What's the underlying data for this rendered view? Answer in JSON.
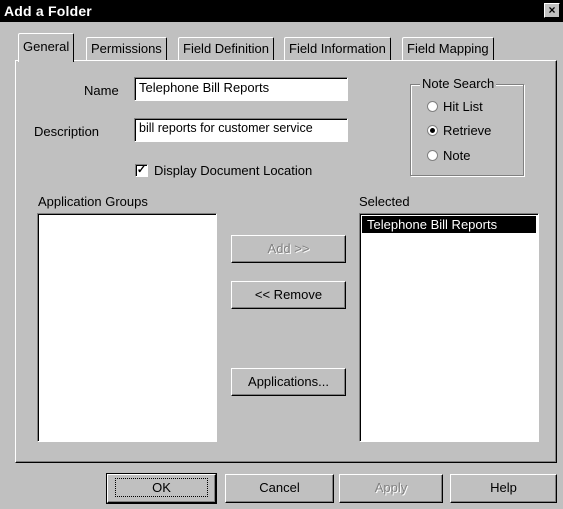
{
  "window": {
    "title": "Add a Folder",
    "close_glyph": "×"
  },
  "tabs": [
    {
      "label": "General",
      "active": true
    },
    {
      "label": "Permissions"
    },
    {
      "label": "Field Definition"
    },
    {
      "label": "Field Information"
    },
    {
      "label": "Field Mapping"
    }
  ],
  "general": {
    "name_label": "Name",
    "name_value": "Telephone Bill Reports",
    "description_label": "Description",
    "description_value": "bill reports for customer service",
    "display_location_label": "Display Document Location",
    "display_location_checked": true,
    "check_glyph": "✓"
  },
  "note_search": {
    "title": "Note Search",
    "options": [
      {
        "label": "Hit List",
        "selected": false
      },
      {
        "label": "Retrieve",
        "selected": true
      },
      {
        "label": "Note",
        "selected": false
      }
    ]
  },
  "application_groups": {
    "label": "Application Groups",
    "items": []
  },
  "selected": {
    "label": "Selected",
    "items": [
      "Telephone Bill Reports"
    ]
  },
  "buttons": {
    "add": "Add >>",
    "remove": "<< Remove",
    "applications": "Applications...",
    "ok": "OK",
    "cancel": "Cancel",
    "apply": "Apply",
    "help": "Help"
  }
}
